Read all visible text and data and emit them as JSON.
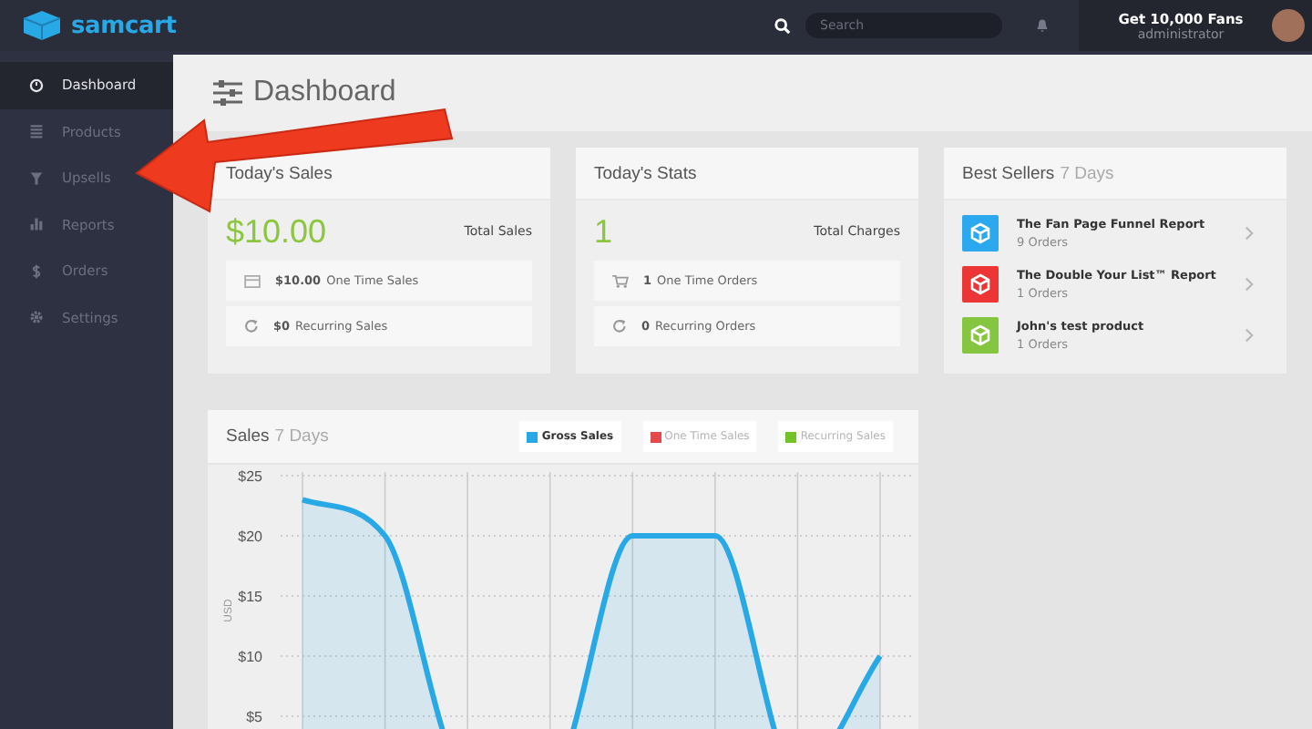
{
  "top_bar": {
    "logo": "samcart",
    "search": {
      "placeholder": "Search"
    },
    "account": {
      "name": "Get 10,000 Fans",
      "role": "administrator"
    }
  },
  "sidebar": {
    "items": [
      {
        "label": "Dashboard",
        "selected": true
      },
      {
        "label": "Products",
        "selected": false
      },
      {
        "label": "Upsells",
        "selected": false
      },
      {
        "label": "Reports",
        "selected": false
      },
      {
        "label": "Orders",
        "selected": false
      },
      {
        "label": "Settings",
        "selected": false
      }
    ]
  },
  "page": {
    "title": "Dashboard"
  },
  "todays_sales": {
    "title": "Today's Sales",
    "total": "$10.00",
    "total_label": "Total Sales",
    "rows": [
      {
        "value": "$10.00",
        "label": "One Time Sales"
      },
      {
        "value": "$0",
        "label": "Recurring Sales"
      }
    ]
  },
  "todays_stats": {
    "title": "Today's Stats",
    "total": "1",
    "total_label": "Total Charges",
    "rows": [
      {
        "value": "1",
        "label": "One Time Orders"
      },
      {
        "value": "0",
        "label": "Recurring Orders"
      }
    ]
  },
  "best_sellers": {
    "title": "Best Sellers",
    "period": "7 Days",
    "items": [
      {
        "name": "The Fan Page Funnel Report",
        "orders": "9 Orders",
        "color": "#2ca8ee"
      },
      {
        "name": "The Double Your List™ Report",
        "orders": "1 Orders",
        "color": "#ec3535"
      },
      {
        "name": "John's test product",
        "orders": "1 Orders",
        "color": "#86c540"
      }
    ]
  },
  "sales_chart": {
    "title": "Sales",
    "period": "7 Days",
    "legend": [
      {
        "selected": true
      },
      {
        "selected": false
      },
      {
        "selected": false
      }
    ],
    "chart_data": {
      "type": "area",
      "grid": true,
      "ylabel": "USD",
      "ylim": [
        0,
        25
      ],
      "yticks": [
        {
          "value": 5,
          "label": "$5"
        },
        {
          "value": 10,
          "label": "$10"
        },
        {
          "value": 15,
          "label": "$15"
        },
        {
          "value": 20,
          "label": "$20"
        },
        {
          "value": 25,
          "label": "$25"
        }
      ],
      "series": [
        {
          "name": "Gross Sales",
          "color": "#29a8e6",
          "values": [
            23,
            20,
            0,
            0,
            20,
            20,
            0,
            10
          ]
        },
        {
          "name": "One Time Sales",
          "color": "#e5484d",
          "values": [
            null,
            null,
            null,
            null,
            null,
            null,
            null,
            null
          ]
        },
        {
          "name": "Recurring Sales",
          "color": "#72c22a",
          "values": [
            null,
            null,
            null,
            null,
            null,
            null,
            null,
            null
          ]
        }
      ]
    }
  },
  "annotation": {
    "kind": "arrow"
  }
}
